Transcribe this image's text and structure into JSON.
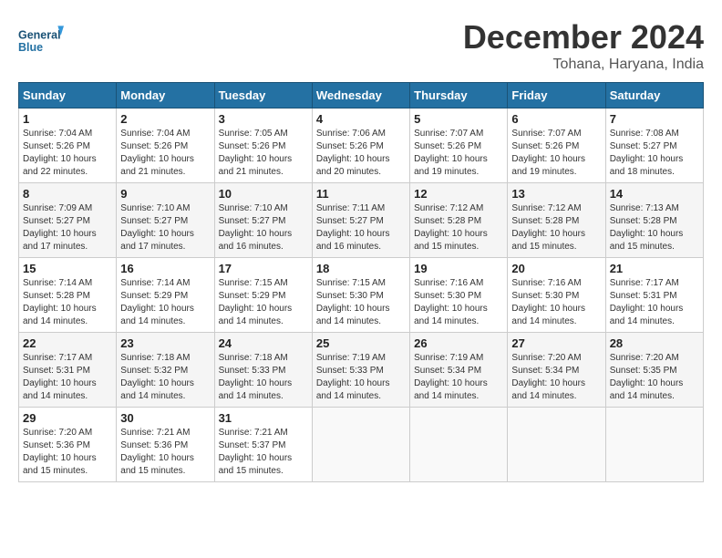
{
  "header": {
    "logo_line1": "General",
    "logo_line2": "Blue",
    "month": "December 2024",
    "location": "Tohana, Haryana, India"
  },
  "weekdays": [
    "Sunday",
    "Monday",
    "Tuesday",
    "Wednesday",
    "Thursday",
    "Friday",
    "Saturday"
  ],
  "weeks": [
    [
      {
        "day": "1",
        "info": "Sunrise: 7:04 AM\nSunset: 5:26 PM\nDaylight: 10 hours\nand 22 minutes."
      },
      {
        "day": "2",
        "info": "Sunrise: 7:04 AM\nSunset: 5:26 PM\nDaylight: 10 hours\nand 21 minutes."
      },
      {
        "day": "3",
        "info": "Sunrise: 7:05 AM\nSunset: 5:26 PM\nDaylight: 10 hours\nand 21 minutes."
      },
      {
        "day": "4",
        "info": "Sunrise: 7:06 AM\nSunset: 5:26 PM\nDaylight: 10 hours\nand 20 minutes."
      },
      {
        "day": "5",
        "info": "Sunrise: 7:07 AM\nSunset: 5:26 PM\nDaylight: 10 hours\nand 19 minutes."
      },
      {
        "day": "6",
        "info": "Sunrise: 7:07 AM\nSunset: 5:26 PM\nDaylight: 10 hours\nand 19 minutes."
      },
      {
        "day": "7",
        "info": "Sunrise: 7:08 AM\nSunset: 5:27 PM\nDaylight: 10 hours\nand 18 minutes."
      }
    ],
    [
      {
        "day": "8",
        "info": "Sunrise: 7:09 AM\nSunset: 5:27 PM\nDaylight: 10 hours\nand 17 minutes."
      },
      {
        "day": "9",
        "info": "Sunrise: 7:10 AM\nSunset: 5:27 PM\nDaylight: 10 hours\nand 17 minutes."
      },
      {
        "day": "10",
        "info": "Sunrise: 7:10 AM\nSunset: 5:27 PM\nDaylight: 10 hours\nand 16 minutes."
      },
      {
        "day": "11",
        "info": "Sunrise: 7:11 AM\nSunset: 5:27 PM\nDaylight: 10 hours\nand 16 minutes."
      },
      {
        "day": "12",
        "info": "Sunrise: 7:12 AM\nSunset: 5:28 PM\nDaylight: 10 hours\nand 15 minutes."
      },
      {
        "day": "13",
        "info": "Sunrise: 7:12 AM\nSunset: 5:28 PM\nDaylight: 10 hours\nand 15 minutes."
      },
      {
        "day": "14",
        "info": "Sunrise: 7:13 AM\nSunset: 5:28 PM\nDaylight: 10 hours\nand 15 minutes."
      }
    ],
    [
      {
        "day": "15",
        "info": "Sunrise: 7:14 AM\nSunset: 5:28 PM\nDaylight: 10 hours\nand 14 minutes."
      },
      {
        "day": "16",
        "info": "Sunrise: 7:14 AM\nSunset: 5:29 PM\nDaylight: 10 hours\nand 14 minutes."
      },
      {
        "day": "17",
        "info": "Sunrise: 7:15 AM\nSunset: 5:29 PM\nDaylight: 10 hours\nand 14 minutes."
      },
      {
        "day": "18",
        "info": "Sunrise: 7:15 AM\nSunset: 5:30 PM\nDaylight: 10 hours\nand 14 minutes."
      },
      {
        "day": "19",
        "info": "Sunrise: 7:16 AM\nSunset: 5:30 PM\nDaylight: 10 hours\nand 14 minutes."
      },
      {
        "day": "20",
        "info": "Sunrise: 7:16 AM\nSunset: 5:30 PM\nDaylight: 10 hours\nand 14 minutes."
      },
      {
        "day": "21",
        "info": "Sunrise: 7:17 AM\nSunset: 5:31 PM\nDaylight: 10 hours\nand 14 minutes."
      }
    ],
    [
      {
        "day": "22",
        "info": "Sunrise: 7:17 AM\nSunset: 5:31 PM\nDaylight: 10 hours\nand 14 minutes."
      },
      {
        "day": "23",
        "info": "Sunrise: 7:18 AM\nSunset: 5:32 PM\nDaylight: 10 hours\nand 14 minutes."
      },
      {
        "day": "24",
        "info": "Sunrise: 7:18 AM\nSunset: 5:33 PM\nDaylight: 10 hours\nand 14 minutes."
      },
      {
        "day": "25",
        "info": "Sunrise: 7:19 AM\nSunset: 5:33 PM\nDaylight: 10 hours\nand 14 minutes."
      },
      {
        "day": "26",
        "info": "Sunrise: 7:19 AM\nSunset: 5:34 PM\nDaylight: 10 hours\nand 14 minutes."
      },
      {
        "day": "27",
        "info": "Sunrise: 7:20 AM\nSunset: 5:34 PM\nDaylight: 10 hours\nand 14 minutes."
      },
      {
        "day": "28",
        "info": "Sunrise: 7:20 AM\nSunset: 5:35 PM\nDaylight: 10 hours\nand 14 minutes."
      }
    ],
    [
      {
        "day": "29",
        "info": "Sunrise: 7:20 AM\nSunset: 5:36 PM\nDaylight: 10 hours\nand 15 minutes."
      },
      {
        "day": "30",
        "info": "Sunrise: 7:21 AM\nSunset: 5:36 PM\nDaylight: 10 hours\nand 15 minutes."
      },
      {
        "day": "31",
        "info": "Sunrise: 7:21 AM\nSunset: 5:37 PM\nDaylight: 10 hours\nand 15 minutes."
      },
      {
        "day": "",
        "info": ""
      },
      {
        "day": "",
        "info": ""
      },
      {
        "day": "",
        "info": ""
      },
      {
        "day": "",
        "info": ""
      }
    ]
  ]
}
